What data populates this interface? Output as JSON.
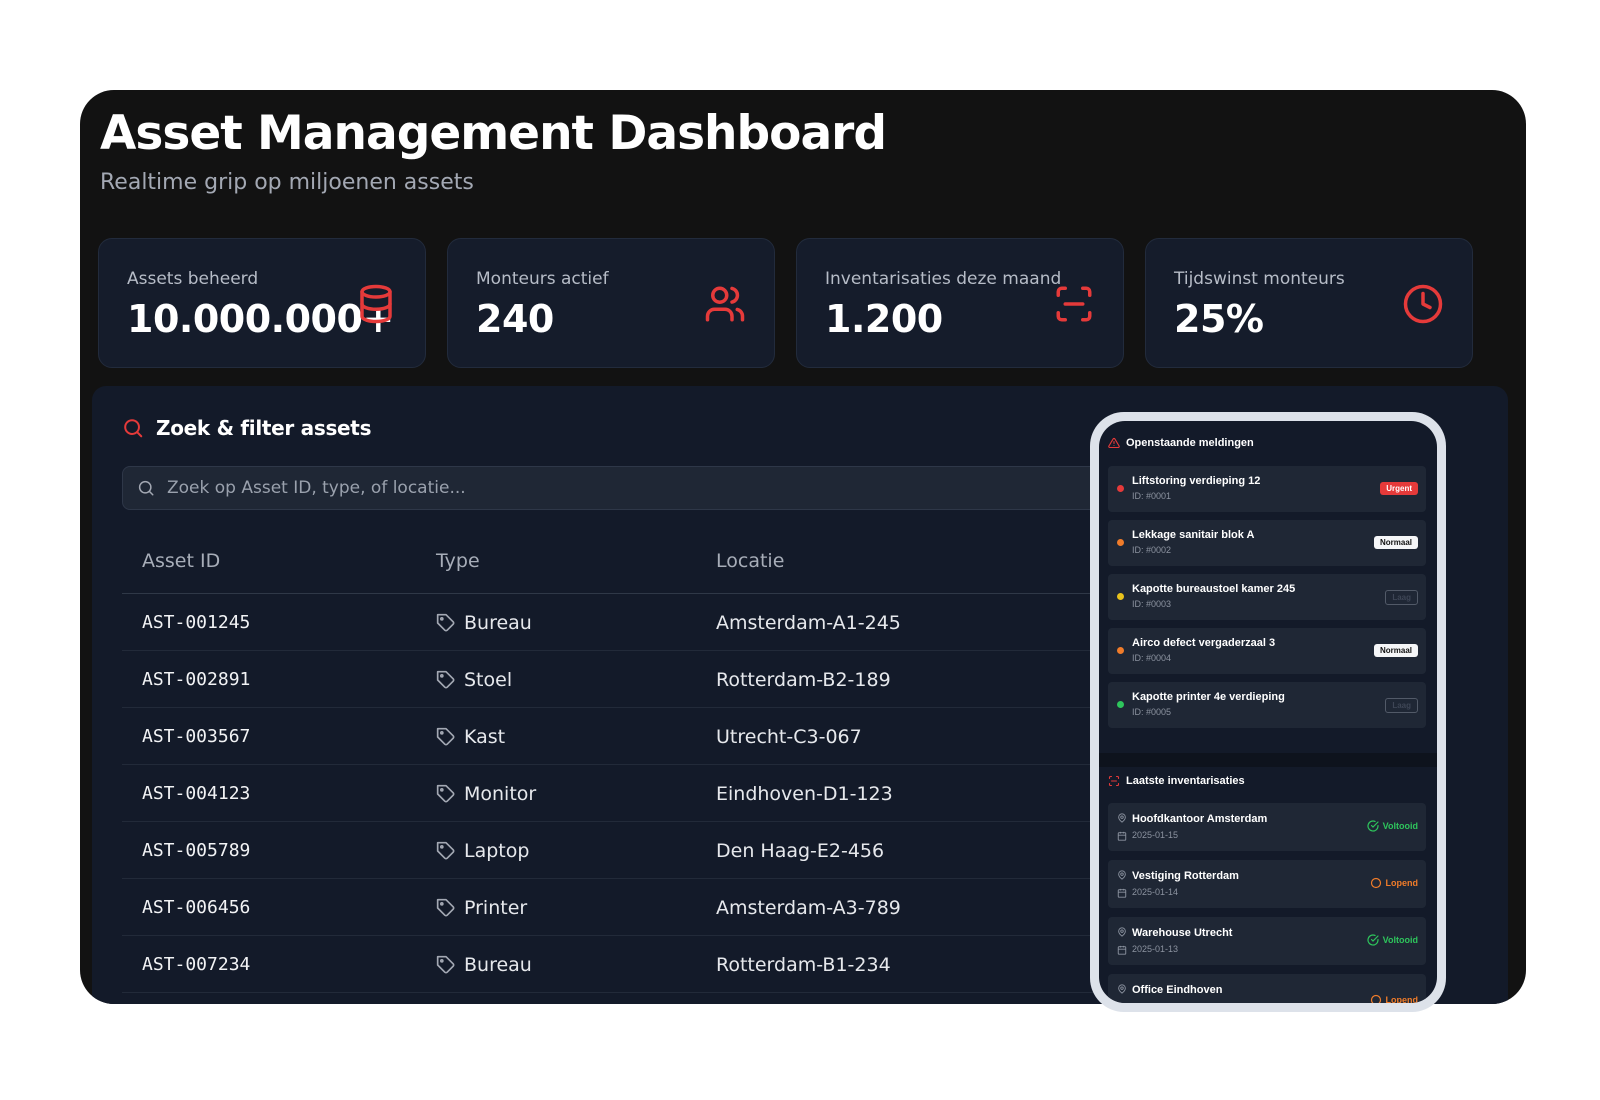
{
  "header": {
    "title": "Asset Management Dashboard",
    "subtitle": "Realtime grip op miljoenen assets"
  },
  "stats": [
    {
      "label": "Assets beheerd",
      "value": "10.000.000+",
      "icon": "database-icon"
    },
    {
      "label": "Monteurs actief",
      "value": "240",
      "icon": "users-icon"
    },
    {
      "label": "Inventarisaties deze maand",
      "value": "1.200",
      "icon": "scan-icon"
    },
    {
      "label": "Tijdswinst monteurs",
      "value": "25%",
      "icon": "clock-icon"
    }
  ],
  "search": {
    "title": "Zoek & filter assets",
    "placeholder": "Zoek op Asset ID, type, of locatie..."
  },
  "table": {
    "headers": [
      "Asset ID",
      "Type",
      "Locatie"
    ],
    "rows": [
      {
        "id": "AST-001245",
        "type": "Bureau",
        "location": "Amsterdam-A1-245"
      },
      {
        "id": "AST-002891",
        "type": "Stoel",
        "location": "Rotterdam-B2-189"
      },
      {
        "id": "AST-003567",
        "type": "Kast",
        "location": "Utrecht-C3-067"
      },
      {
        "id": "AST-004123",
        "type": "Monitor",
        "location": "Eindhoven-D1-123"
      },
      {
        "id": "AST-005789",
        "type": "Laptop",
        "location": "Den Haag-E2-456"
      },
      {
        "id": "AST-006456",
        "type": "Printer",
        "location": "Amsterdam-A3-789"
      },
      {
        "id": "AST-007234",
        "type": "Bureau",
        "location": "Rotterdam-B1-234"
      }
    ]
  },
  "phone": {
    "alerts_title": "Openstaande meldingen",
    "alerts": [
      {
        "title": "Liftstoring verdieping 12",
        "id": "ID: #0001",
        "priority": "Urgent",
        "dot_color": "#e53a3a"
      },
      {
        "title": "Lekkage sanitair blok A",
        "id": "ID: #0002",
        "priority": "Normaal",
        "dot_color": "#f07c2a"
      },
      {
        "title": "Kapotte bureaustoel kamer 245",
        "id": "ID: #0003",
        "priority": "Laag",
        "dot_color": "#e8c21c"
      },
      {
        "title": "Airco defect vergaderzaal 3",
        "id": "ID: #0004",
        "priority": "Normaal",
        "dot_color": "#f07c2a"
      },
      {
        "title": "Kapotte printer 4e verdieping",
        "id": "ID: #0005",
        "priority": "Laag",
        "dot_color": "#2ec55c"
      }
    ],
    "inventories_title": "Laatste inventarisaties",
    "inventories": [
      {
        "title": "Hoofdkantoor Amsterdam",
        "date": "2025-01-15",
        "status": "Voltooid"
      },
      {
        "title": "Vestiging Rotterdam",
        "date": "2025-01-14",
        "status": "Lopend"
      },
      {
        "title": "Warehouse Utrecht",
        "date": "2025-01-13",
        "status": "Voltooid"
      },
      {
        "title": "Office Eindhoven",
        "date": "",
        "status": "Lopend"
      }
    ]
  },
  "colors": {
    "accent": "#e53a3a",
    "success": "#2ec55c",
    "warning": "#f07c2a",
    "background": "#121212",
    "panel": "#131a29"
  }
}
